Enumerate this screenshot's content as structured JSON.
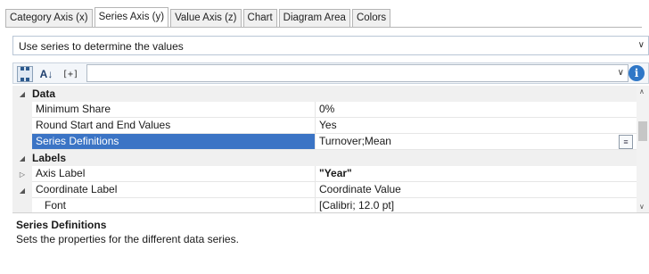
{
  "tabs": [
    "Category Axis (x)",
    "Series Axis (y)",
    "Value Axis (z)",
    "Chart",
    "Diagram Area",
    "Colors"
  ],
  "active_tab": 1,
  "series_select": {
    "value": "Use series to determine the values"
  },
  "toolbar": {
    "expand_label": "[+]",
    "info_glyph": "i",
    "az_glyph": "A↓"
  },
  "grid": {
    "data_category": "Data",
    "rows": {
      "min_share": {
        "name": "Minimum Share",
        "value": "0%"
      },
      "round": {
        "name": "Round Start and End Values",
        "value": "Yes"
      },
      "series_defs": {
        "name": "Series Definitions",
        "value": "Turnover;Mean"
      }
    },
    "labels_category": "Labels",
    "label_rows": {
      "axis_label": {
        "name": "Axis Label",
        "value": "\"Year\""
      },
      "coord_label": {
        "name": "Coordinate Label",
        "value": "Coordinate Value"
      },
      "font": {
        "name": "Font",
        "value": "[Calibri; 12.0 pt]"
      }
    }
  },
  "description": {
    "title": "Series Definitions",
    "text": "Sets the properties for the different data series."
  },
  "colors": {
    "selection": "#3b74c5",
    "info": "#2f77c7"
  }
}
